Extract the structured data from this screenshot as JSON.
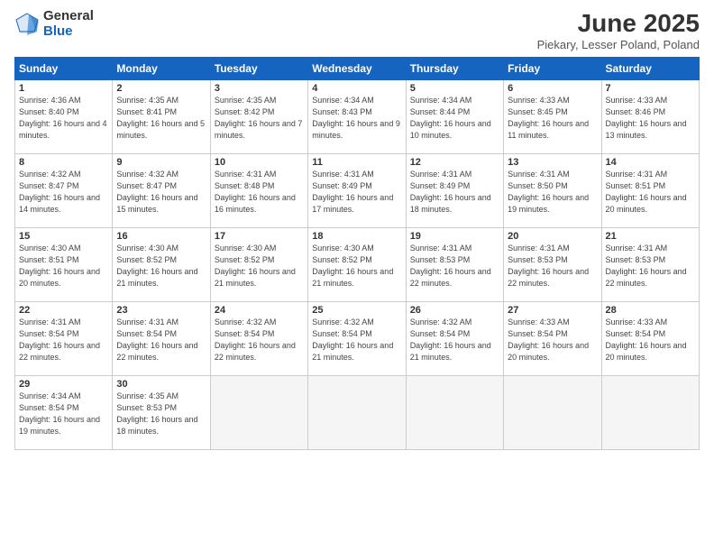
{
  "header": {
    "logo_general": "General",
    "logo_blue": "Blue",
    "main_title": "June 2025",
    "subtitle": "Piekary, Lesser Poland, Poland"
  },
  "calendar": {
    "days_header": [
      "Sunday",
      "Monday",
      "Tuesday",
      "Wednesday",
      "Thursday",
      "Friday",
      "Saturday"
    ],
    "weeks": [
      [
        {
          "day": "1",
          "sunrise": "4:36 AM",
          "sunset": "8:40 PM",
          "daylight": "16 hours and 4 minutes."
        },
        {
          "day": "2",
          "sunrise": "4:35 AM",
          "sunset": "8:41 PM",
          "daylight": "16 hours and 5 minutes."
        },
        {
          "day": "3",
          "sunrise": "4:35 AM",
          "sunset": "8:42 PM",
          "daylight": "16 hours and 7 minutes."
        },
        {
          "day": "4",
          "sunrise": "4:34 AM",
          "sunset": "8:43 PM",
          "daylight": "16 hours and 9 minutes."
        },
        {
          "day": "5",
          "sunrise": "4:34 AM",
          "sunset": "8:44 PM",
          "daylight": "16 hours and 10 minutes."
        },
        {
          "day": "6",
          "sunrise": "4:33 AM",
          "sunset": "8:45 PM",
          "daylight": "16 hours and 11 minutes."
        },
        {
          "day": "7",
          "sunrise": "4:33 AM",
          "sunset": "8:46 PM",
          "daylight": "16 hours and 13 minutes."
        }
      ],
      [
        {
          "day": "8",
          "sunrise": "4:32 AM",
          "sunset": "8:47 PM",
          "daylight": "16 hours and 14 minutes."
        },
        {
          "day": "9",
          "sunrise": "4:32 AM",
          "sunset": "8:47 PM",
          "daylight": "16 hours and 15 minutes."
        },
        {
          "day": "10",
          "sunrise": "4:31 AM",
          "sunset": "8:48 PM",
          "daylight": "16 hours and 16 minutes."
        },
        {
          "day": "11",
          "sunrise": "4:31 AM",
          "sunset": "8:49 PM",
          "daylight": "16 hours and 17 minutes."
        },
        {
          "day": "12",
          "sunrise": "4:31 AM",
          "sunset": "8:49 PM",
          "daylight": "16 hours and 18 minutes."
        },
        {
          "day": "13",
          "sunrise": "4:31 AM",
          "sunset": "8:50 PM",
          "daylight": "16 hours and 19 minutes."
        },
        {
          "day": "14",
          "sunrise": "4:31 AM",
          "sunset": "8:51 PM",
          "daylight": "16 hours and 20 minutes."
        }
      ],
      [
        {
          "day": "15",
          "sunrise": "4:30 AM",
          "sunset": "8:51 PM",
          "daylight": "16 hours and 20 minutes."
        },
        {
          "day": "16",
          "sunrise": "4:30 AM",
          "sunset": "8:52 PM",
          "daylight": "16 hours and 21 minutes."
        },
        {
          "day": "17",
          "sunrise": "4:30 AM",
          "sunset": "8:52 PM",
          "daylight": "16 hours and 21 minutes."
        },
        {
          "day": "18",
          "sunrise": "4:30 AM",
          "sunset": "8:52 PM",
          "daylight": "16 hours and 21 minutes."
        },
        {
          "day": "19",
          "sunrise": "4:31 AM",
          "sunset": "8:53 PM",
          "daylight": "16 hours and 22 minutes."
        },
        {
          "day": "20",
          "sunrise": "4:31 AM",
          "sunset": "8:53 PM",
          "daylight": "16 hours and 22 minutes."
        },
        {
          "day": "21",
          "sunrise": "4:31 AM",
          "sunset": "8:53 PM",
          "daylight": "16 hours and 22 minutes."
        }
      ],
      [
        {
          "day": "22",
          "sunrise": "4:31 AM",
          "sunset": "8:54 PM",
          "daylight": "16 hours and 22 minutes."
        },
        {
          "day": "23",
          "sunrise": "4:31 AM",
          "sunset": "8:54 PM",
          "daylight": "16 hours and 22 minutes."
        },
        {
          "day": "24",
          "sunrise": "4:32 AM",
          "sunset": "8:54 PM",
          "daylight": "16 hours and 22 minutes."
        },
        {
          "day": "25",
          "sunrise": "4:32 AM",
          "sunset": "8:54 PM",
          "daylight": "16 hours and 21 minutes."
        },
        {
          "day": "26",
          "sunrise": "4:32 AM",
          "sunset": "8:54 PM",
          "daylight": "16 hours and 21 minutes."
        },
        {
          "day": "27",
          "sunrise": "4:33 AM",
          "sunset": "8:54 PM",
          "daylight": "16 hours and 20 minutes."
        },
        {
          "day": "28",
          "sunrise": "4:33 AM",
          "sunset": "8:54 PM",
          "daylight": "16 hours and 20 minutes."
        }
      ],
      [
        {
          "day": "29",
          "sunrise": "4:34 AM",
          "sunset": "8:54 PM",
          "daylight": "16 hours and 19 minutes."
        },
        {
          "day": "30",
          "sunrise": "4:35 AM",
          "sunset": "8:53 PM",
          "daylight": "16 hours and 18 minutes."
        },
        null,
        null,
        null,
        null,
        null
      ]
    ]
  }
}
